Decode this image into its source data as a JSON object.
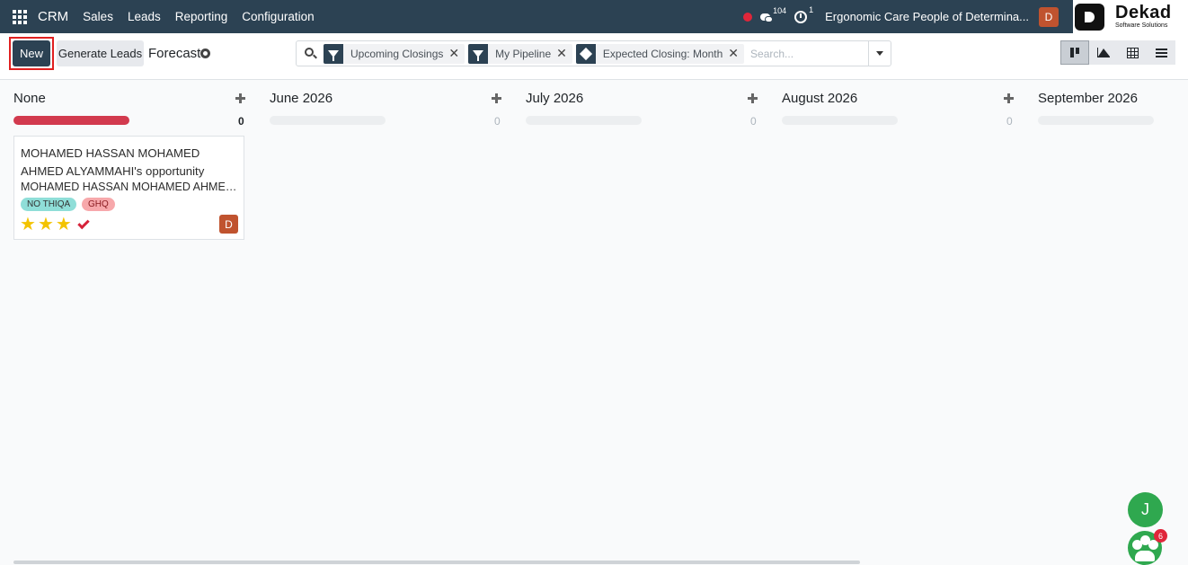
{
  "navbar": {
    "app_name": "CRM",
    "menu": [
      "Sales",
      "Leads",
      "Reporting",
      "Configuration"
    ],
    "messages_count": "104",
    "activities_count": "1",
    "company": "Ergonomic Care People of Determina...",
    "user_initial": "D",
    "logo": {
      "name": "Dekad",
      "tagline": "Software Solutions"
    }
  },
  "control": {
    "new_label": "New",
    "generate_label": "Generate Leads",
    "title": "Forecast"
  },
  "search": {
    "facets": [
      {
        "icon": "filter-icon",
        "label": "Upcoming Closings"
      },
      {
        "icon": "filter-icon",
        "label": "My Pipeline"
      },
      {
        "icon": "group-by-icon",
        "label": "Expected Closing: Month"
      }
    ],
    "placeholder": "Search..."
  },
  "views": [
    "kanban",
    "graph",
    "pivot",
    "list"
  ],
  "columns": [
    {
      "name": "None",
      "count": "0"
    },
    {
      "name": "June 2026",
      "count": "0"
    },
    {
      "name": "July 2026",
      "count": "0"
    },
    {
      "name": "August 2026",
      "count": "0"
    },
    {
      "name": "September 2026",
      "count": "0"
    }
  ],
  "card": {
    "title": "MOHAMED HASSAN MOHAMED AHMED ALYAMMAHI's opportunity",
    "customer": "MOHAMED HASSAN MOHAMED AHMED A...",
    "tags": [
      "NO THIQA",
      "GHQ"
    ],
    "priority_stars": 3,
    "assignee_initial": "D"
  },
  "floating": {
    "chat_initial": "J",
    "group_badge": "6"
  },
  "colors": {
    "navbar": "#2c4253",
    "accent_red": "#d23a4e",
    "star": "#f3c300",
    "chat_green": "#2fa84f"
  }
}
